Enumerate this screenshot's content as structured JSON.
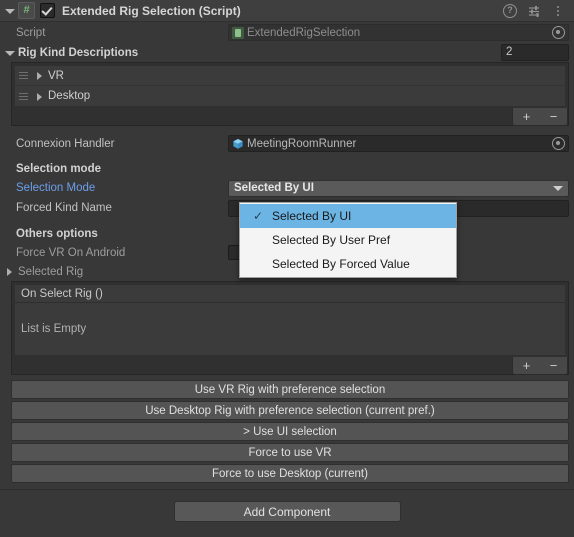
{
  "component": {
    "title": "Extended Rig Selection (Script)",
    "enabled": true,
    "script_icon": "#",
    "header_icons": {
      "help": "?",
      "preset": "preset-icon",
      "menu": "more-menu-icon"
    }
  },
  "script_row": {
    "label": "Script",
    "value": "ExtendedRigSelection"
  },
  "rig_kind_descriptions": {
    "label": "Rig Kind Descriptions",
    "size": "2",
    "items": [
      {
        "label": "VR"
      },
      {
        "label": "Desktop"
      }
    ],
    "add_button": "+",
    "remove_button": "−"
  },
  "connexion_handler": {
    "label": "Connexion Handler",
    "value": "MeetingRoomRunner"
  },
  "selection_section": {
    "header": "Selection mode",
    "selection_mode_label": "Selection Mode",
    "selection_mode_value": "Selected By UI",
    "forced_kind_name_label": "Forced Kind Name",
    "forced_kind_name_value": ""
  },
  "dropdown": {
    "open": true,
    "options": [
      {
        "label": "Selected By UI",
        "selected": true,
        "check": "✓"
      },
      {
        "label": "Selected By User Pref",
        "selected": false,
        "check": ""
      },
      {
        "label": "Selected By Forced Value",
        "selected": false,
        "check": ""
      }
    ]
  },
  "others_section": {
    "header": "Others options",
    "force_vr_on_android_label": "Force VR On Android",
    "selected_rig_label": "Selected Rig"
  },
  "on_select_rig": {
    "header": "On Select Rig ()",
    "empty_text": "List is Empty",
    "add_button": "+",
    "remove_button": "−"
  },
  "action_buttons": [
    {
      "label": "Use VR Rig with preference selection"
    },
    {
      "label": "Use Desktop Rig with preference selection (current pref.)"
    },
    {
      "label": "> Use UI selection"
    },
    {
      "label": "Force to use VR"
    },
    {
      "label": "Force to use Desktop  (current)"
    }
  ],
  "add_component": {
    "label": "Add Component"
  },
  "colors": {
    "background": "#383838",
    "header": "#3f3f3f",
    "accent_label": "#6d9eeb",
    "dropdown_highlight": "#6cb4e4",
    "dropdown_bg": "#f4f4f4",
    "field_bg": "#2a2a2a",
    "button_bg": "#545454"
  }
}
